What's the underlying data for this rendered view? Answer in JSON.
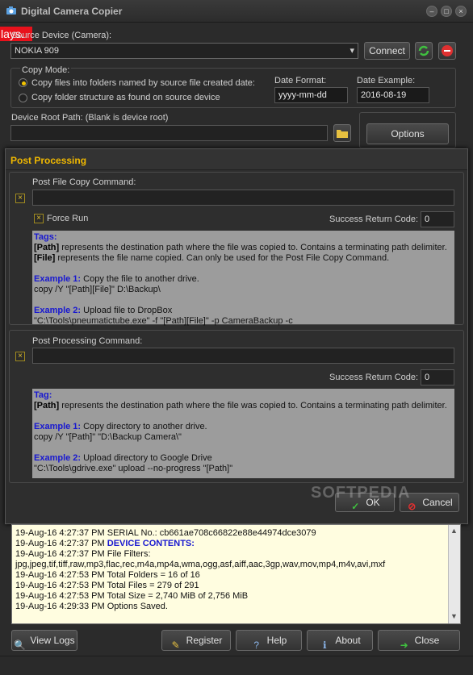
{
  "window": {
    "title": "Digital Camera Copier",
    "overlay_tag": "lays."
  },
  "source": {
    "label": "Source Device (Camera):",
    "device": "NOKIA 909",
    "connect": "Connect"
  },
  "copy_mode": {
    "label": "Copy Mode:",
    "option1": "Copy files into folders named by source file created date:",
    "option2": "Copy folder structure as found on source device",
    "date_format_label": "Date Format:",
    "date_format": "yyyy-mm-dd",
    "date_example_label": "Date Example:",
    "date_example": "2016-08-19"
  },
  "device_root": {
    "label": "Device Root Path: (Blank is device root)",
    "value": ""
  },
  "options_button": "Options",
  "dialog": {
    "title": "Post Processing",
    "file_cmd_label": "Post File Copy Command:",
    "file_cmd_value": "",
    "force_run": "Force Run",
    "success_label": "Success Return Code:",
    "success_value": "0",
    "file_help": {
      "tags": "Tags:",
      "path_tag": "[Path]",
      "path_desc": " represents the destination path where the file was copied to. Contains a terminating path delimiter.",
      "file_tag": "[File]",
      "file_desc": " represents the file name copied. Can only be used for the Post File Copy Command.",
      "ex1_label": "Example 1:",
      "ex1_desc": " Copy the file to another drive.",
      "ex1_cmd": "copy /Y \"[Path][File]\" D:\\Backup\\",
      "ex2_label": "Example 2:",
      "ex2_desc": " Upload file to DropBox",
      "ex2_cmd": "\"C:\\Tools\\pneumatictube.exe\" -f \"[Path][File]\" -p CameraBackup -c"
    },
    "proc_cmd_label": "Post Processing Command:",
    "proc_cmd_value": "",
    "success2_label": "Success Return Code:",
    "success2_value": "0",
    "proc_help": {
      "tag": "Tag:",
      "path_tag": "[Path]",
      "path_desc": " represents the destination path where the file was copied to. Contains a terminating path delimiter.",
      "ex1_label": "Example 1:",
      "ex1_desc": " Copy directory to another drive.",
      "ex1_cmd": "copy /Y \"[Path]\" \"D:\\Backup Camera\\\"",
      "ex2_label": "Example 2:",
      "ex2_desc": " Upload directory to Google Drive",
      "ex2_cmd": "\"C:\\Tools\\gdrive.exe\" upload --no-progress \"[Path]\""
    },
    "ok": "OK",
    "cancel": "Cancel"
  },
  "log": [
    {
      "pre": "19-Aug-16 4:27:37 PM SERIAL No.: cb661ae708c66822e88e44974dce3079",
      "blue": ""
    },
    {
      "pre": "19-Aug-16 4:27:37 PM ",
      "blue": "DEVICE CONTENTS:"
    },
    {
      "pre": "19-Aug-16 4:27:37 PM File Filters:",
      "blue": ""
    },
    {
      "pre": "jpg,jpeg,tif,tiff,raw,mp3,flac,rec,m4a,mp4a,wma,ogg,asf,aiff,aac,3gp,wav,mov,mp4,m4v,avi,mxf",
      "blue": ""
    },
    {
      "pre": "19-Aug-16 4:27:53 PM Total Folders = 16 of 16",
      "blue": ""
    },
    {
      "pre": "19-Aug-16 4:27:53 PM Total Files = 279 of 291",
      "blue": ""
    },
    {
      "pre": "19-Aug-16 4:27:53 PM Total Size = 2,740 MiB of 2,756 MiB",
      "blue": ""
    },
    {
      "pre": "19-Aug-16 4:29:33 PM Options Saved.",
      "blue": ""
    }
  ],
  "buttons": {
    "view_logs": "View Logs",
    "register": "Register",
    "help": "Help",
    "about": "About",
    "close": "Close"
  },
  "watermark": "SOFTPEDIA",
  "colors": {
    "accent": "#f0b800",
    "link_blue": "#1818d0",
    "log_bg": "#fffde0"
  }
}
